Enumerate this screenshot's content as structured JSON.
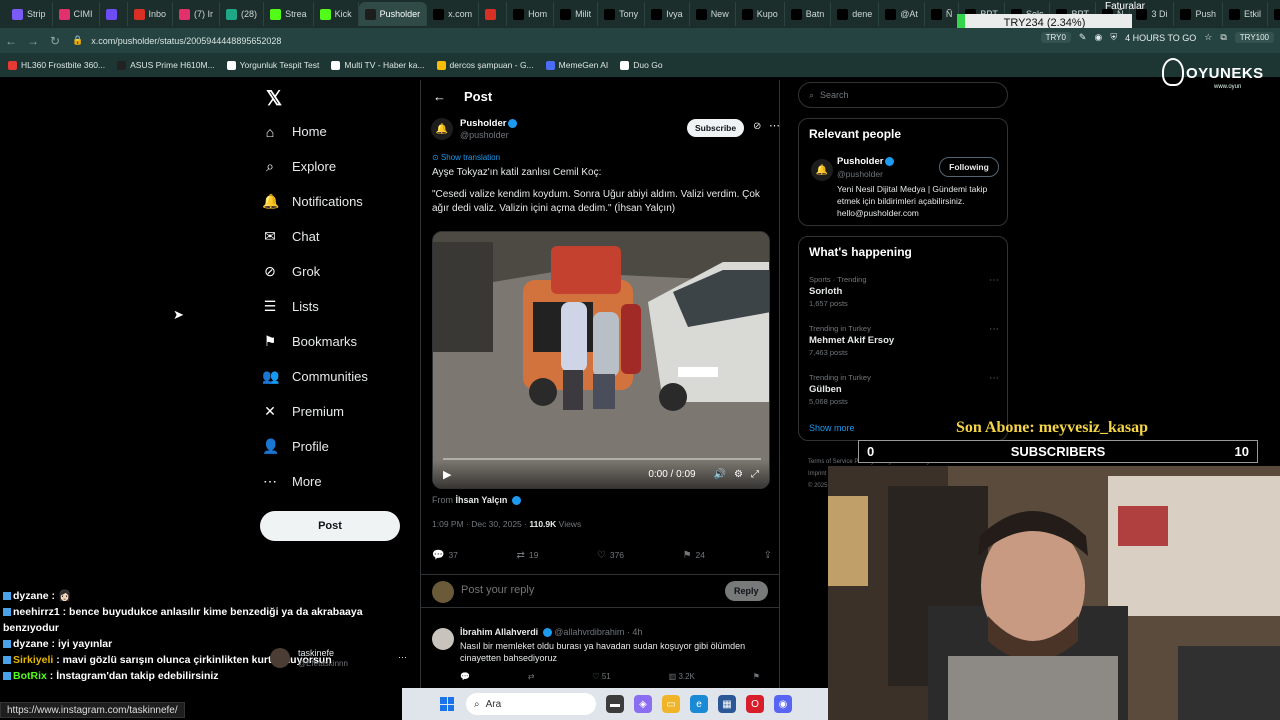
{
  "browser": {
    "tabs": [
      {
        "label": "Strip",
        "color": "#7a5af8"
      },
      {
        "label": "CIMI",
        "color": "#e1306c"
      },
      {
        "label": "",
        "color": "#6c4cf5"
      },
      {
        "label": "Inbo",
        "color": "#d93025"
      },
      {
        "label": "(7) Ir",
        "color": "#e1306c"
      },
      {
        "label": "(28)",
        "color": "#1ea885"
      },
      {
        "label": "Strea",
        "color": "#53fc18"
      },
      {
        "label": "Kick",
        "color": "#53fc18"
      },
      {
        "label": "Pusholder",
        "color": "#1d1d1d"
      },
      {
        "label": "x.com",
        "color": "#000000"
      },
      {
        "label": "",
        "color": "#d93025"
      },
      {
        "label": "Hom",
        "color": "#000000"
      },
      {
        "label": "Milit",
        "color": "#000000"
      },
      {
        "label": "Tony",
        "color": "#000000"
      },
      {
        "label": "Ivya",
        "color": "#000000"
      },
      {
        "label": "New",
        "color": "#000000"
      },
      {
        "label": "Kupo",
        "color": "#000000"
      },
      {
        "label": "Batn",
        "color": "#000000"
      },
      {
        "label": "dene",
        "color": "#000000"
      },
      {
        "label": "@At",
        "color": "#000000"
      },
      {
        "label": "Ñ",
        "color": "#000000"
      },
      {
        "label": "BPT",
        "color": "#000000"
      },
      {
        "label": "Solc",
        "color": "#000000"
      },
      {
        "label": "BPT",
        "color": "#000000"
      },
      {
        "label": "Ñ",
        "color": "#000000"
      },
      {
        "label": "3 Di",
        "color": "#000000"
      },
      {
        "label": "Push",
        "color": "#000000"
      },
      {
        "label": "Etkil",
        "color": "#000000"
      },
      {
        "label": "ihsa",
        "color": "#000000"
      }
    ],
    "active_tab_index": 8,
    "faturalar": "Faturalar",
    "ticker": "TRY234 (2.34%)",
    "url": "x.com/pusholder/status/2005944448895652028",
    "ext_try": "TRY0",
    "ext_timer": "4 HOURS TO GO",
    "ext_try2": "TRY100",
    "bookmarks": [
      {
        "label": "HL360 Frostbite 360...",
        "color": "#e53935"
      },
      {
        "label": "ASUS Prime H610M...",
        "color": "#222222"
      },
      {
        "label": "Yorgunluk Tespit Test",
        "color": "#ffffff"
      },
      {
        "label": "Multi TV - Haber ka...",
        "color": "#ffffff"
      },
      {
        "label": "dercos şampuan - G...",
        "color": "#fbbc05"
      },
      {
        "label": "MemeGen AI",
        "color": "#4a6cf7"
      },
      {
        "label": "Duo Go",
        "color": "#ffffff"
      }
    ]
  },
  "nav": {
    "items": [
      {
        "label": "Home",
        "icon": "⌂"
      },
      {
        "label": "Explore",
        "icon": "⌕"
      },
      {
        "label": "Notifications",
        "icon": "🔔"
      },
      {
        "label": "Chat",
        "icon": "✉"
      },
      {
        "label": "Grok",
        "icon": "⊘"
      },
      {
        "label": "Lists",
        "icon": "☰"
      },
      {
        "label": "Bookmarks",
        "icon": "⚑"
      },
      {
        "label": "Communities",
        "icon": "👥"
      },
      {
        "label": "Premium",
        "icon": "✕"
      },
      {
        "label": "Profile",
        "icon": "👤"
      },
      {
        "label": "More",
        "icon": "⋯"
      }
    ],
    "post_button": "Post"
  },
  "post": {
    "header": "Post",
    "author_name": "Pusholder",
    "author_handle": "@pusholder",
    "subscribe": "Subscribe",
    "show_translation": "Show translation",
    "text_line1": "Ayşe Tokyaz'ın katil zanlısı Cemil Koç:",
    "text_line2": "\"Cesedi valize kendim koydum. Sonra Uğur abiyi aldım. Valizi verdim. Çok ağır dedi valiz. Valizin içini açma dedim.\" (İhsan Yalçın)",
    "video_time": "0:00 / 0:09",
    "from_label": "From",
    "from_name": "İhsan Yalçın",
    "time": "1:09 PM · Dec 30, 2025 ·",
    "views": "110.9K",
    "views_label": "Views",
    "replies": "37",
    "reposts": "19",
    "likes": "376",
    "bookmarks": "24",
    "reply_placeholder": "Post your reply",
    "reply_button": "Reply"
  },
  "reply1": {
    "name": "İbrahim Allahverdi",
    "handle": "@allahvrdibrahim · 4h",
    "text": "Nasıl bir memleket oldu burası ya havadan sudan koşuyor gibi ölümden cinayetten bahsediyoruz",
    "likes": "51",
    "views": "3.2K"
  },
  "sidebar": {
    "search_placeholder": "Search",
    "relevant_title": "Relevant people",
    "rp_name": "Pusholder",
    "rp_handle": "@pusholder",
    "rp_button": "Following",
    "rp_bio": "Yeni Nesil Dijital Medya | Gündemi takip etmek için bildirimleri açabilirsiniz. hello@pusholder.com",
    "happening_title": "What's happening",
    "trends": [
      {
        "category": "Sports · Trending",
        "name": "Sorloth",
        "posts": "1,657 posts"
      },
      {
        "category": "Trending in Turkey",
        "name": "Mehmet Akif Ersoy",
        "posts": "7,463 posts"
      },
      {
        "category": "Trending in Turkey",
        "name": "Gülben",
        "posts": "5,068 posts"
      }
    ],
    "show_more": "Show more",
    "footer1": "Terms of Service  Privacy Policy  Cookie Policy",
    "footer2": "Imprint",
    "footer3": "© 2025"
  },
  "overlay": {
    "brand": "OYUNEKS",
    "brand_sub": "www.oyun",
    "son_abone": "Son Abone: meyvesiz_kasap",
    "subs_min": "0",
    "subs_label": "SUBSCRIBERS",
    "subs_max": "10",
    "subs_progress": 0.0
  },
  "chat": [
    {
      "user": "dyzane",
      "message": "👩🏻",
      "color": "#ffffff"
    },
    {
      "user": "neehirrz1",
      "message": "bence buyudukce anlasılır kime benzediği ya da akrabaaya benzıyodur",
      "color": "#ffffff"
    },
    {
      "user": "dyzane",
      "message": "iyi yayınlar",
      "color": "#ffffff"
    },
    {
      "user": "Sirkiyeli",
      "message": "mavi gözlü sarışın olunca çirkinlikten kurtulmuyorsun",
      "color": "#e6b800"
    },
    {
      "user": "BotRix",
      "message": "İnstagram'dan takip edebilirsiniz",
      "color": "#53fc18"
    }
  ],
  "chat_card": {
    "name": "taskinefe",
    "handle": "@Efetaskinnn"
  },
  "status_url": "https://www.instagram.com/taskinnefe/",
  "taskbar": {
    "search": "Ara"
  }
}
